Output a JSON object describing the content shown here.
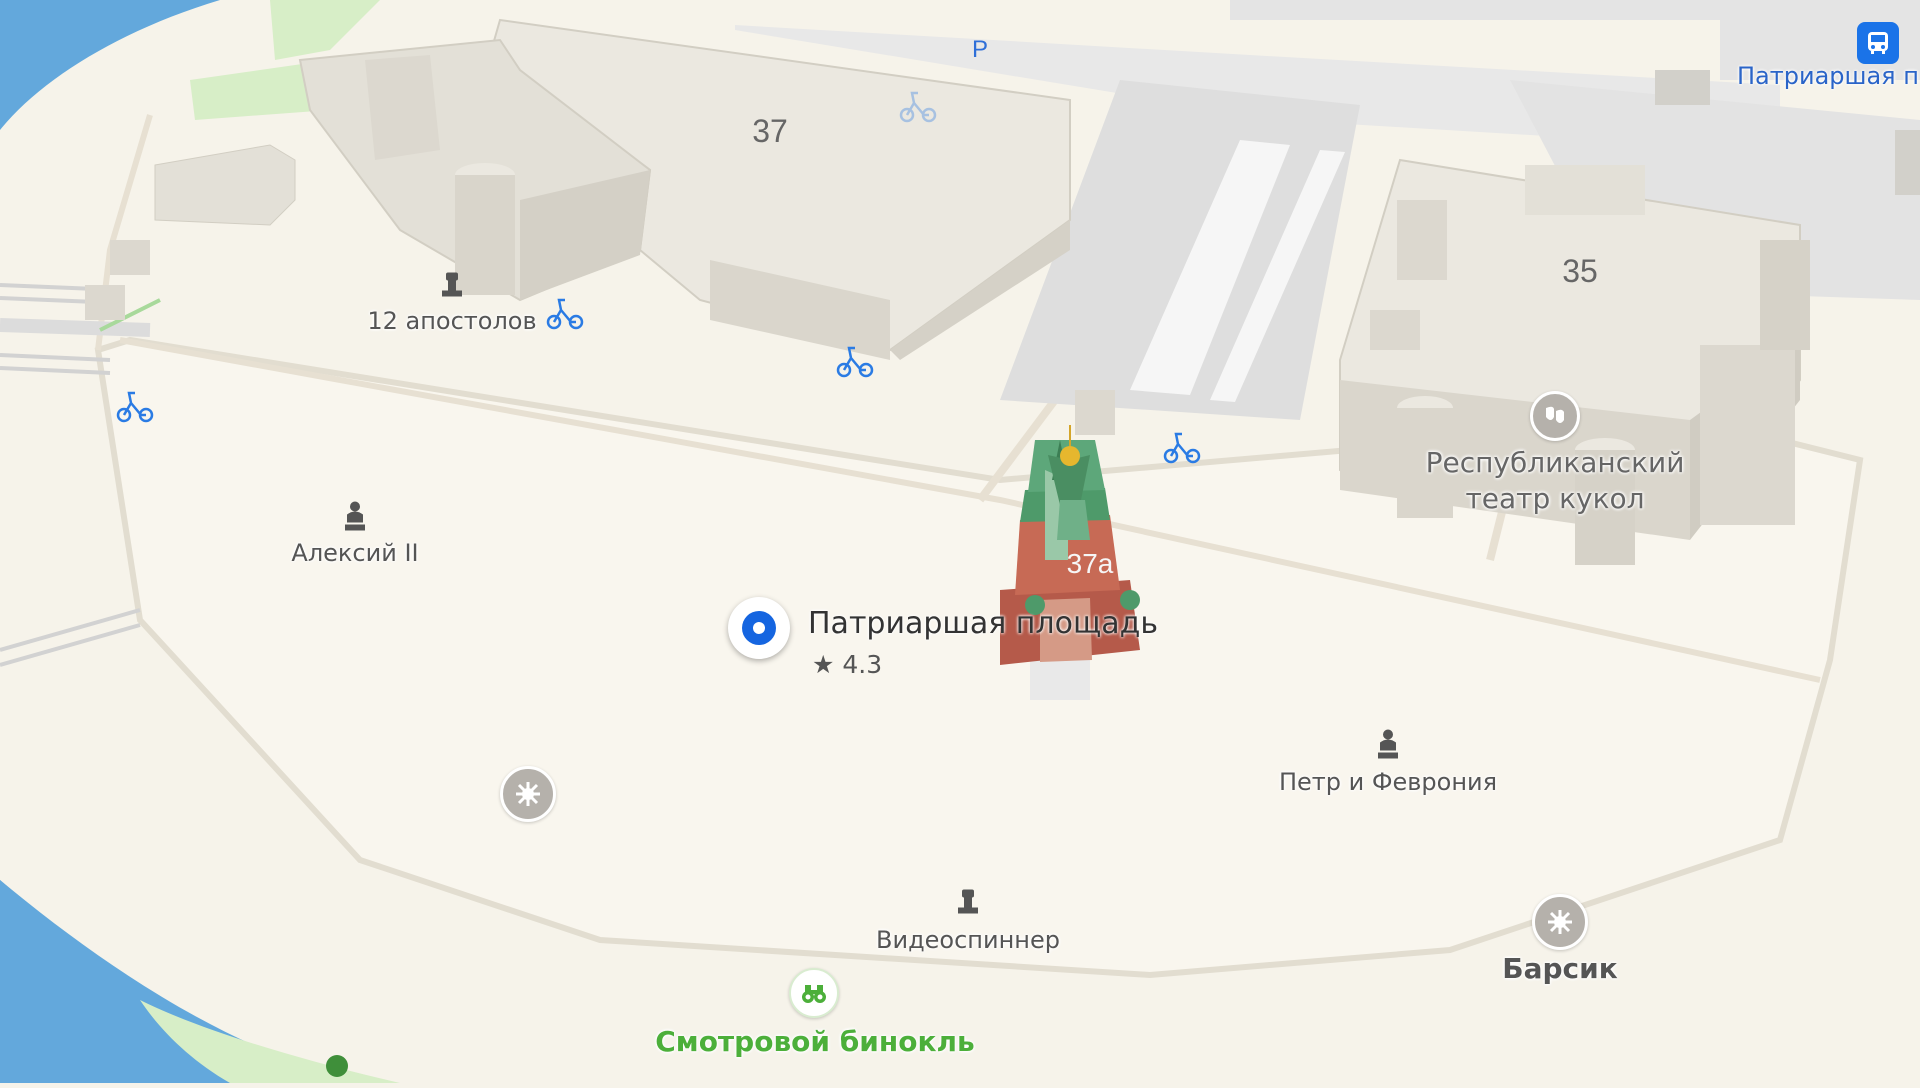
{
  "map": {
    "colors": {
      "water": "#63a8dc",
      "land": "#f6f3ea",
      "park": "#d7eec7",
      "building": "#e5e2d8",
      "road": "#dcdcdc",
      "accent": "#1565e0",
      "green_label": "#4caf3a"
    },
    "buildings": {
      "b37": "37",
      "b35": "35",
      "b37a": "37а"
    },
    "poi": {
      "apostles": "12 апостолов",
      "alexy": "Алексий II",
      "petr": "Петр и Феврония",
      "videospinner": "Видеоспиннер",
      "barsik": "Барсик",
      "binoculars": "Смотровой бинокль",
      "theatre_line1": "Республиканский",
      "theatre_line2": "театр кукол",
      "parking": "P",
      "bus_stop": "Патриаршая п"
    },
    "selected_place": {
      "name": "Патриаршая площадь",
      "rating": "★ 4.3"
    },
    "icons": [
      "monument-icon",
      "statue-icon",
      "bicycle-icon",
      "theatre-icon",
      "attraction-icon",
      "binoculars-icon",
      "bus-icon",
      "place-pin-icon",
      "church-3d-model"
    ]
  }
}
